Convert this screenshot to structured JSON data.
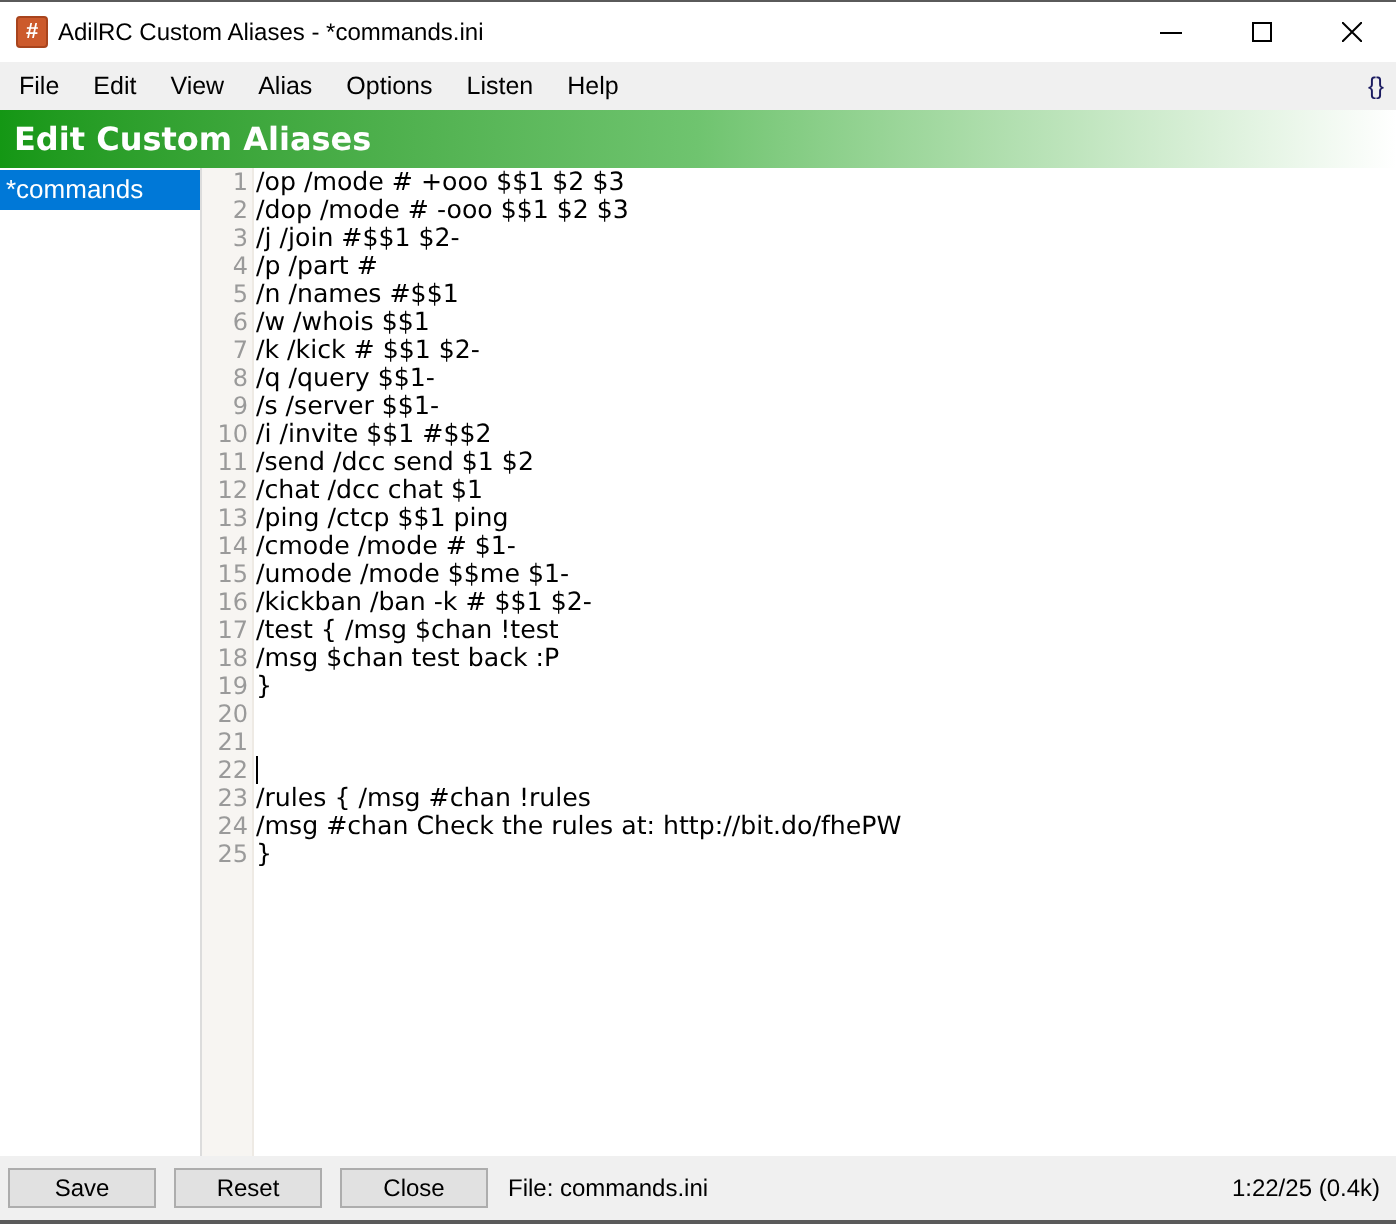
{
  "window": {
    "icon": "#",
    "title": "AdilRC Custom Aliases - *commands.ini"
  },
  "menu": {
    "items": [
      "File",
      "Edit",
      "View",
      "Alias",
      "Options",
      "Listen",
      "Help"
    ],
    "extra": "{}"
  },
  "header": {
    "title": "Edit Custom Aliases"
  },
  "sidebar": {
    "items": [
      {
        "label": "*commands",
        "selected": true
      }
    ]
  },
  "editor": {
    "lines": [
      {
        "number": "1",
        "text": "/op /mode # +ooo $$1 $2 $3",
        "caret": false
      },
      {
        "number": "2",
        "text": "/dop /mode # -ooo $$1 $2 $3",
        "caret": false
      },
      {
        "number": "3",
        "text": "/j /join #$$1 $2-",
        "caret": false
      },
      {
        "number": "4",
        "text": "/p /part #",
        "caret": false
      },
      {
        "number": "5",
        "text": "/n /names #$$1",
        "caret": false
      },
      {
        "number": "6",
        "text": "/w /whois $$1",
        "caret": false
      },
      {
        "number": "7",
        "text": "/k /kick # $$1 $2-",
        "caret": false
      },
      {
        "number": "8",
        "text": "/q /query $$1-",
        "caret": false
      },
      {
        "number": "9",
        "text": "/s /server $$1-",
        "caret": false
      },
      {
        "number": "10",
        "text": "/i /invite $$1 #$$2",
        "caret": false
      },
      {
        "number": "11",
        "text": "/send /dcc send $1 $2",
        "caret": false
      },
      {
        "number": "12",
        "text": "/chat /dcc chat $1",
        "caret": false
      },
      {
        "number": "13",
        "text": "/ping /ctcp $$1 ping",
        "caret": false
      },
      {
        "number": "14",
        "text": "/cmode /mode # $1-",
        "caret": false
      },
      {
        "number": "15",
        "text": "/umode /mode $$me $1-",
        "caret": false
      },
      {
        "number": "16",
        "text": "/kickban /ban -k # $$1 $2-",
        "caret": false
      },
      {
        "number": "17",
        "text": "/test { /msg $chan !test",
        "caret": false
      },
      {
        "number": "18",
        "text": "/msg $chan test back :P",
        "caret": false
      },
      {
        "number": "19",
        "text": "}",
        "caret": false
      },
      {
        "number": "20",
        "caret": false
      },
      {
        "number": "21",
        "caret": false
      },
      {
        "number": "22",
        "caret": true
      },
      {
        "number": "23",
        "text": "/rules { /msg #chan !rules",
        "caret": false
      },
      {
        "number": "24",
        "text": "/msg #chan Check the rules at: http://bit.do/fhePW",
        "caret": false
      },
      {
        "number": "25",
        "text": "}",
        "caret": false
      }
    ]
  },
  "footer": {
    "buttons": [
      "Save",
      "Reset",
      "Close"
    ],
    "file": "File: commands.ini",
    "position": "1:22/25 (0.4k)"
  }
}
